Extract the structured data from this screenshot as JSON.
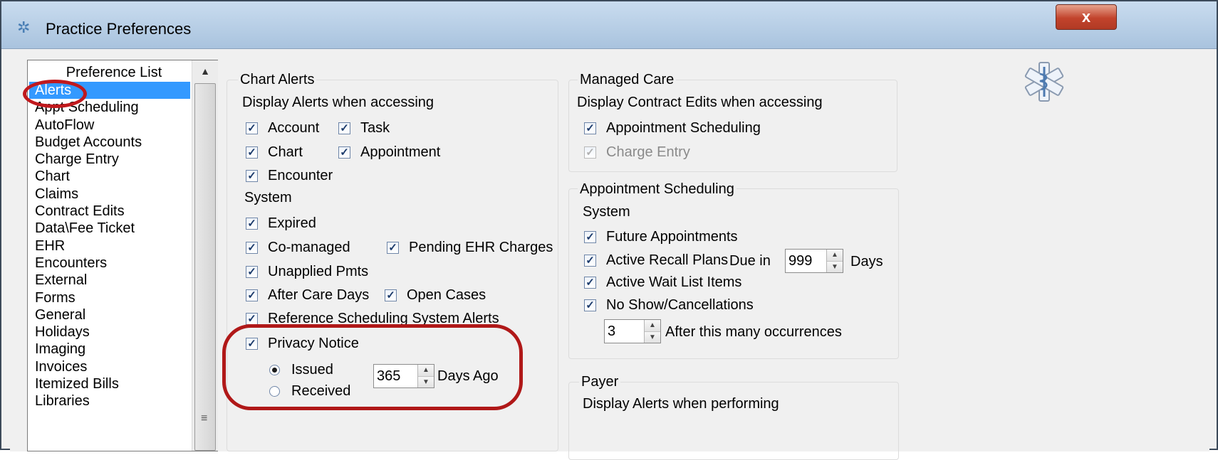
{
  "window": {
    "title": "Practice Preferences",
    "close_label": "x"
  },
  "preference_list": {
    "header": "Preference List",
    "items": [
      "Alerts",
      "Appt Scheduling",
      "AutoFlow",
      "Budget Accounts",
      "Charge Entry",
      "Chart",
      "Claims",
      "Contract Edits",
      "Data\\Fee Ticket",
      "EHR",
      "Encounters",
      "External",
      "Forms",
      "General",
      "Holidays",
      "Imaging",
      "Invoices",
      "Itemized Bills",
      "Libraries"
    ],
    "selected": "Alerts"
  },
  "chart_alerts": {
    "title": "Chart Alerts",
    "display_header": "Display Alerts when accessing",
    "account": "Account",
    "task": "Task",
    "chart": "Chart",
    "appointment": "Appointment",
    "encounter": "Encounter",
    "system_header": "System",
    "expired": "Expired",
    "co_managed": "Co-managed",
    "pending_ehr": "Pending EHR Charges",
    "unapplied": "Unapplied Pmts",
    "after_care": "After Care Days",
    "open_cases": "Open Cases",
    "reference": "Reference Scheduling System Alerts",
    "privacy": "Privacy Notice",
    "issued": "Issued",
    "received": "Received",
    "days_value": "365",
    "days_ago": "Days Ago"
  },
  "managed_care": {
    "title": "Managed Care",
    "header": "Display Contract Edits when accessing",
    "appt": "Appointment Scheduling",
    "charge": "Charge Entry"
  },
  "appointment_scheduling": {
    "title": "Appointment Scheduling",
    "system": "System",
    "future": "Future Appointments",
    "recall": "Active Recall Plans",
    "due_in": "Due in",
    "recall_days": "999",
    "days": "Days",
    "waitlist": "Active Wait List Items",
    "noshow": "No Show/Cancellations",
    "occurrences_value": "3",
    "occurrences_label": "After this many occurrences"
  },
  "payer": {
    "title": "Payer",
    "header": "Display Alerts when performing"
  },
  "check_glyph": "✓",
  "icons": {
    "app": "caduceus-icon",
    "logo": "star-of-life-icon"
  },
  "colors": {
    "highlight": "#c0191d",
    "selection": "#3399ff"
  }
}
